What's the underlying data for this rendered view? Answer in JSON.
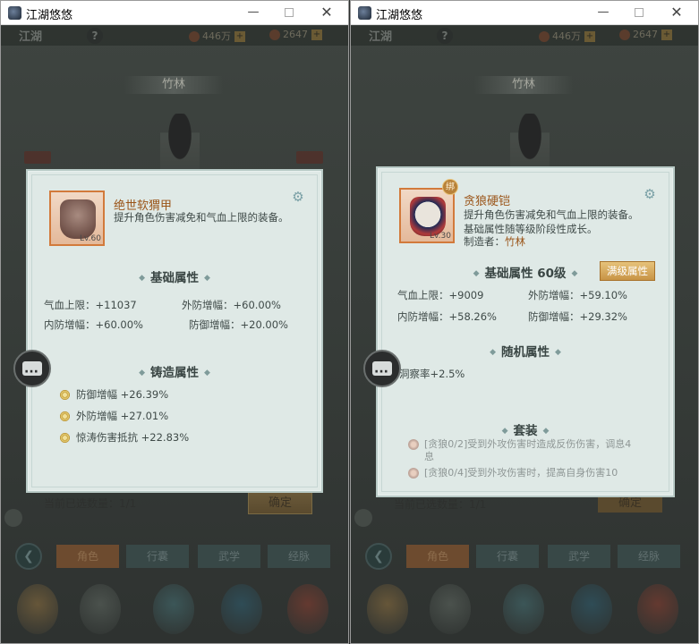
{
  "app_title": "江湖悠悠",
  "window_controls": {
    "minimize": "—",
    "close": "✕"
  },
  "colors": {
    "accent_orange": "#9a5418",
    "panel_bg": "#dfe9e6",
    "full_attr_gold": "#c89446"
  },
  "game_bg": {
    "logo": "江湖",
    "help": "?",
    "res1": "446万",
    "res2": "2647",
    "location": "竹林",
    "nav_tabs": [
      "角色",
      "行囊",
      "武学",
      "经脉"
    ],
    "confirm_label": "确定",
    "selected_count_label": "当前已选数量：1/1"
  },
  "left": {
    "item_name": "绝世软猬甲",
    "item_level": "Lv.60",
    "item_desc": "提升角色伤害减免和气血上限的装备。",
    "base_header": "基础属性",
    "base_stats": [
      {
        "label": "气血上限：",
        "value": "+11037"
      },
      {
        "label": "外防增幅：",
        "value": "+60.00%"
      },
      {
        "label": "内防增幅：",
        "value": "+60.00%"
      },
      {
        "label": "防御增幅：",
        "value": "+20.00%"
      }
    ],
    "forge_header": "铸造属性",
    "forge_stats": [
      {
        "label": "防御增幅",
        "value": "+26.39%"
      },
      {
        "label": "外防增幅",
        "value": "+27.01%"
      },
      {
        "label": "惊涛伤害抵抗",
        "value": "+22.83%"
      }
    ],
    "footer_count": "当前已选数量：1/1",
    "footer_confirm": "确定"
  },
  "right": {
    "bind_badge": "绑",
    "item_name": "贪狼硬铠",
    "item_level": "Lv.30",
    "item_desc": "提升角色伤害减免和气血上限的装备。基础属性随等级阶段性成长。",
    "maker_label": "制造者：",
    "maker_name": "竹林",
    "base_header": "基础属性",
    "base_level": "60级",
    "full_attr_btn": "满级属性",
    "base_stats": [
      {
        "label": "气血上限：",
        "value": "+9009"
      },
      {
        "label": "外防增幅：",
        "value": "+59.10%"
      },
      {
        "label": "内防增幅：",
        "value": "+58.26%"
      },
      {
        "label": "防御增幅：",
        "value": "+29.32%"
      }
    ],
    "random_header": "随机属性",
    "random_stats": [
      {
        "text": "洞察率+2.5%"
      }
    ],
    "set_header": "套装",
    "set_rows": [
      {
        "text": "[贪狼0/2]受到外攻伤害时造成反伤伤害，调息4息"
      },
      {
        "text": "[贪狼0/4]受到外攻伤害时，提高自身伤害10"
      }
    ],
    "footer_count": "当前已选数量：1/1",
    "footer_confirm": "确定"
  }
}
